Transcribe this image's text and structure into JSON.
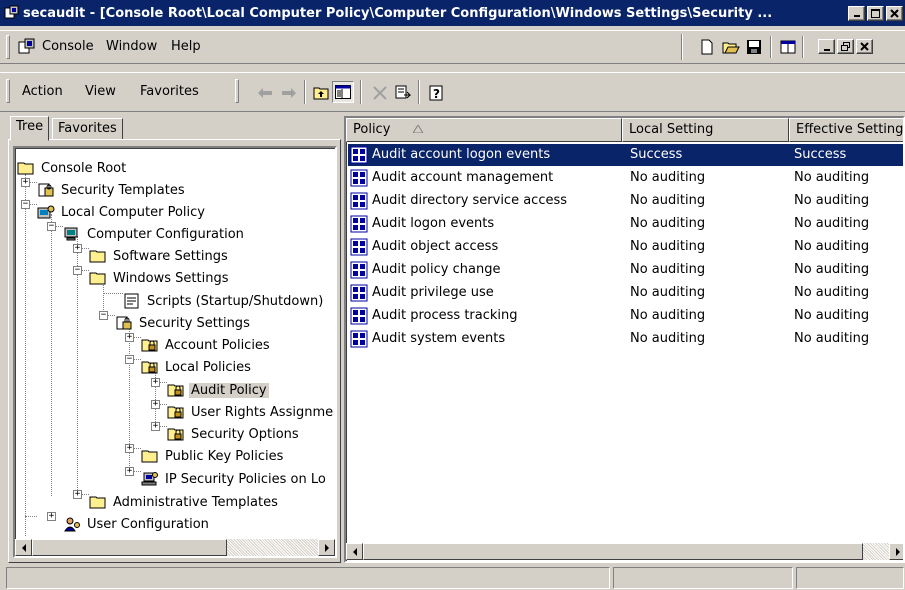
{
  "window": {
    "title": "secaudit - [Console Root\\Local Computer Policy\\Computer Configuration\\Windows Settings\\Security ..."
  },
  "menubar": {
    "items": [
      "Console",
      "Window",
      "Help"
    ]
  },
  "toolbar": {
    "menu_items": [
      "Action",
      "View",
      "Favorites"
    ]
  },
  "tabs": [
    "Tree",
    "Favorites"
  ],
  "tree": {
    "nodes": [
      {
        "label": "Console Root",
        "icon": "folder-icon"
      },
      {
        "label": "Security Templates",
        "icon": "security-templates-icon"
      },
      {
        "label": "Local Computer Policy",
        "icon": "local-policy-icon"
      },
      {
        "label": "Computer Configuration",
        "icon": "computer-icon"
      },
      {
        "label": "Software Settings",
        "icon": "folder-icon"
      },
      {
        "label": "Windows Settings",
        "icon": "folder-icon"
      },
      {
        "label": "Scripts (Startup/Shutdown)",
        "icon": "script-icon"
      },
      {
        "label": "Security Settings",
        "icon": "security-settings-icon"
      },
      {
        "label": "Account Policies",
        "icon": "lock-folder-icon"
      },
      {
        "label": "Local Policies",
        "icon": "lock-folder-icon"
      },
      {
        "label": "Audit Policy",
        "icon": "lock-folder-icon"
      },
      {
        "label": "User Rights Assignme",
        "icon": "lock-folder-icon"
      },
      {
        "label": "Security Options",
        "icon": "lock-folder-icon"
      },
      {
        "label": "Public Key Policies",
        "icon": "folder-icon"
      },
      {
        "label": "IP Security Policies on Lo",
        "icon": "ip-security-icon"
      },
      {
        "label": "Administrative Templates",
        "icon": "folder-icon"
      },
      {
        "label": "User Configuration",
        "icon": "user-config-icon"
      }
    ]
  },
  "list": {
    "columns": [
      "Policy",
      "Local Setting",
      "Effective Setting"
    ],
    "rows": [
      [
        "Audit account logon events",
        "Success",
        "Success"
      ],
      [
        "Audit account management",
        "No auditing",
        "No auditing"
      ],
      [
        "Audit directory service access",
        "No auditing",
        "No auditing"
      ],
      [
        "Audit logon events",
        "No auditing",
        "No auditing"
      ],
      [
        "Audit object access",
        "No auditing",
        "No auditing"
      ],
      [
        "Audit policy change",
        "No auditing",
        "No auditing"
      ],
      [
        "Audit privilege use",
        "No auditing",
        "No auditing"
      ],
      [
        "Audit process tracking",
        "No auditing",
        "No auditing"
      ],
      [
        "Audit system events",
        "No auditing",
        "No auditing"
      ]
    ]
  },
  "colors": {
    "title_bar": "#0a246a",
    "selection": "#0a246a",
    "face": "#d4d0c8"
  }
}
